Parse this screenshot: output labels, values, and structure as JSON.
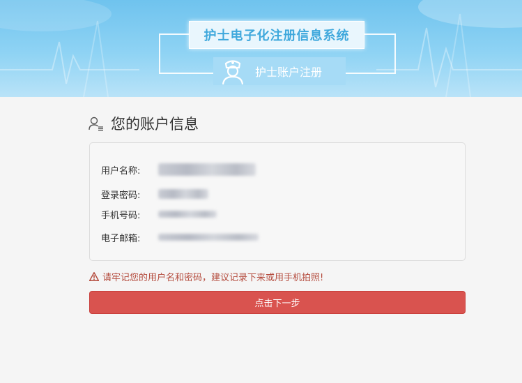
{
  "header": {
    "system_title": "护士电子化注册信息系统",
    "subtitle": "护士账户注册",
    "nurse_icon": "nurse-icon"
  },
  "section": {
    "title": "您的账户信息",
    "icon": "user-icon"
  },
  "account_info": {
    "fields": [
      {
        "label": "用户名称:",
        "value_state": "blurred"
      },
      {
        "label": "登录密码:",
        "value_state": "blurred"
      },
      {
        "label": "手机号码:",
        "value_state": "blurred"
      },
      {
        "label": "电子邮箱:",
        "value_state": "blurred"
      }
    ]
  },
  "warning": {
    "icon": "warning-icon",
    "text": "请牢记您的用户名和密码，建议记录下来或用手机拍照!",
    "color": "#b44a3c"
  },
  "next_button": {
    "label": "点击下一步",
    "color": "#d9534f"
  },
  "colors": {
    "banner": "#8fd3f4",
    "title_text": "#3fa8dc",
    "background": "#f5f5f5"
  }
}
